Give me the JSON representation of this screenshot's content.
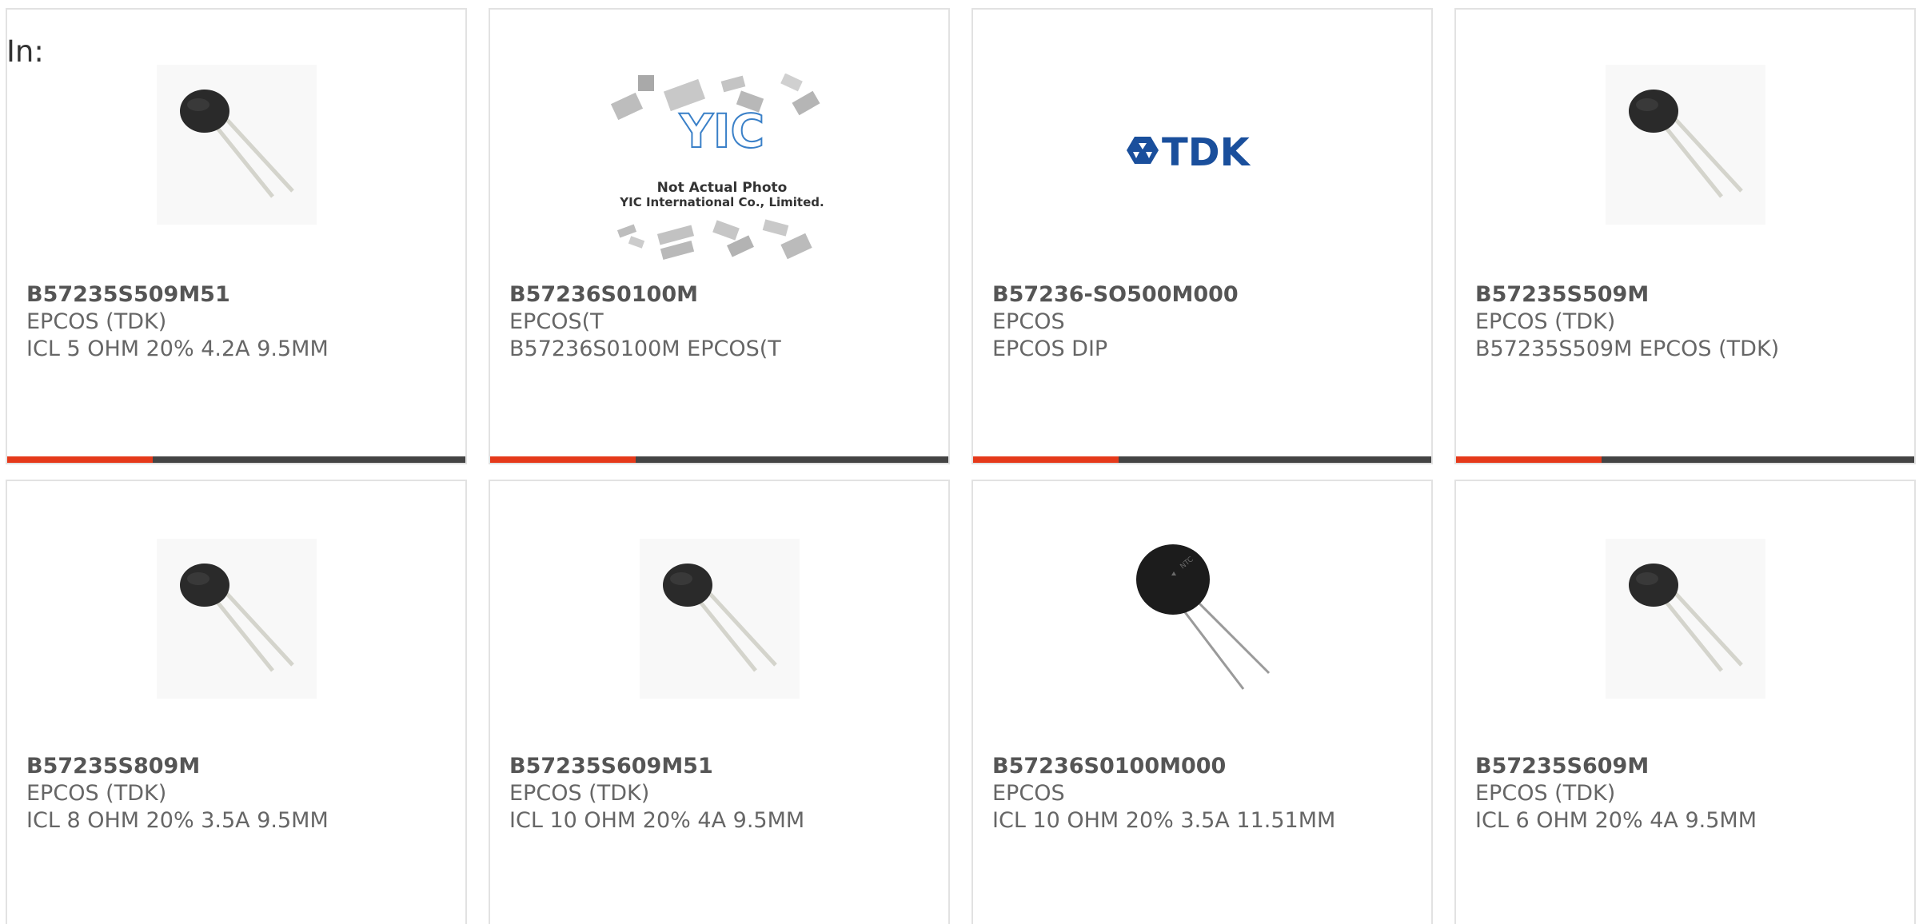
{
  "header": {
    "in_label": "In:"
  },
  "colors": {
    "accent": "#e5391a",
    "bar_dark": "#444444",
    "card_border": "#e2e2e2"
  },
  "products": [
    {
      "part": "B57235S509M51",
      "mfr": "EPCOS (TDK)",
      "desc": "ICL 5 OHM 20% 4.2A 9.5MM",
      "image": "thermistor-icon"
    },
    {
      "part": "B57236S0100M",
      "mfr": "EPCOS(T",
      "desc": "B57236S0100M EPCOS(T",
      "image": "not-actual-photo-placeholder",
      "placeholder": {
        "brand": "YIC",
        "line1": "Not Actual Photo",
        "line2": "YIC International Co., Limited."
      }
    },
    {
      "part": "B57236-SO500M000",
      "mfr": "EPCOS",
      "desc": "EPCOS DIP",
      "image": "tdk-logo",
      "logo_text": "TDK"
    },
    {
      "part": "B57235S509M",
      "mfr": "EPCOS (TDK)",
      "desc": "B57235S509M EPCOS (TDK)",
      "image": "thermistor-icon"
    },
    {
      "part": "B57235S809M",
      "mfr": "EPCOS (TDK)",
      "desc": "ICL 8 OHM 20% 3.5A 9.5MM",
      "image": "thermistor-icon"
    },
    {
      "part": "B57235S609M51",
      "mfr": "EPCOS (TDK)",
      "desc": "ICL 10 OHM 20% 4A 9.5MM",
      "image": "thermistor-icon"
    },
    {
      "part": "B57236S0100M000",
      "mfr": "EPCOS",
      "desc": "ICL 10 OHM 20% 3.5A 11.51MM",
      "image": "large-thermistor-icon"
    },
    {
      "part": "B57235S609M",
      "mfr": "EPCOS (TDK)",
      "desc": "ICL 6 OHM 20% 4A 9.5MM",
      "image": "thermistor-icon"
    }
  ]
}
